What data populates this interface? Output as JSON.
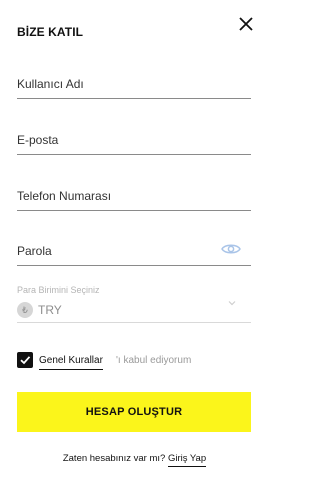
{
  "header": {
    "title": "BİZE KATIL"
  },
  "fields": {
    "username": {
      "placeholder": "Kullanıcı Adı",
      "value": ""
    },
    "email": {
      "placeholder": "E-posta",
      "value": ""
    },
    "phone": {
      "placeholder": "Telefon Numarası",
      "value": ""
    },
    "password": {
      "placeholder": "Parola",
      "value": ""
    }
  },
  "currency": {
    "label": "Para Birimini Seçiniz",
    "symbol": "₺",
    "value": "TRY"
  },
  "terms": {
    "link_label": "Genel Kurallar",
    "rest_label": "'ı kabul ediyorum",
    "checked": true
  },
  "submit": {
    "label": "HESAP OLUŞTUR"
  },
  "login": {
    "prompt": "Zaten hesabınız var mı?",
    "link_label": "Giriş Yap"
  },
  "colors": {
    "accent": "#fbf51b",
    "eye_icon": "#a9c4e8",
    "muted": "#8e8e8e"
  },
  "icons": [
    "close-icon",
    "eye-icon",
    "chevron-down-icon",
    "check-icon",
    "lira-icon"
  ]
}
